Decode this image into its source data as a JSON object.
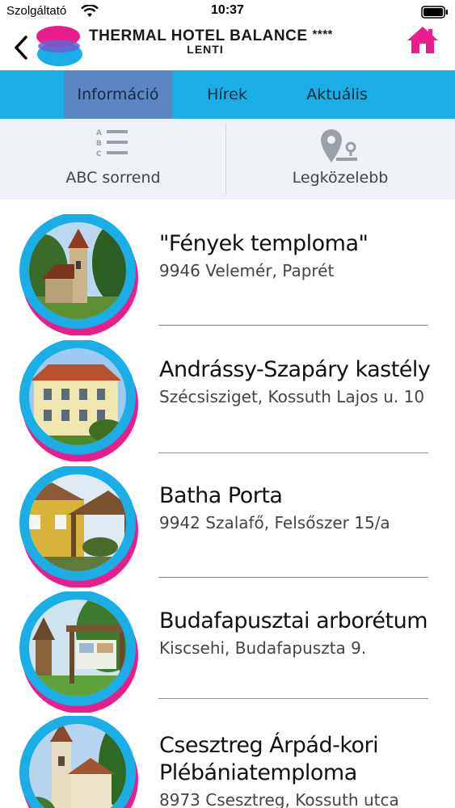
{
  "status": {
    "carrier": "Szolgáltató",
    "time": "10:37"
  },
  "header": {
    "hotel_name": "THERMAL HOTEL BALANCE",
    "stars": "****",
    "city": "LENTI",
    "colors": {
      "brand_pink": "#e91e8c",
      "brand_blue": "#1aaee6"
    }
  },
  "tabs": [
    {
      "label": "Információ",
      "active": true
    },
    {
      "label": "Hírek",
      "active": false
    },
    {
      "label": "Aktuális",
      "active": false
    }
  ],
  "sort": {
    "abc_label": "ABC sorrend",
    "near_label": "Legközelebb",
    "abc_icon": "abc-list-icon",
    "near_icon": "map-pin-icon"
  },
  "items": [
    {
      "title": "\"Fények temploma\"",
      "address": "9946 Velemér, Paprét",
      "image": "chapel-photo"
    },
    {
      "title": "Andrássy-Szapáry kastély",
      "address": "Szécsisziget, Kossuth Lajos u. 10",
      "image": "manor-photo"
    },
    {
      "title": "Batha Porta",
      "address": "9942 Szalafő, Felsőszer 15/a",
      "image": "farmhouse-photo"
    },
    {
      "title": "Budafapusztai arborétum",
      "address": "Kiscsehi, Budafapuszta 9.",
      "image": "arboretum-photo"
    },
    {
      "title": "Csesztreg Árpád-kori Plébániatemploma",
      "address": "8973 Csesztreg, Kossuth utca",
      "image": "church-photo"
    }
  ]
}
